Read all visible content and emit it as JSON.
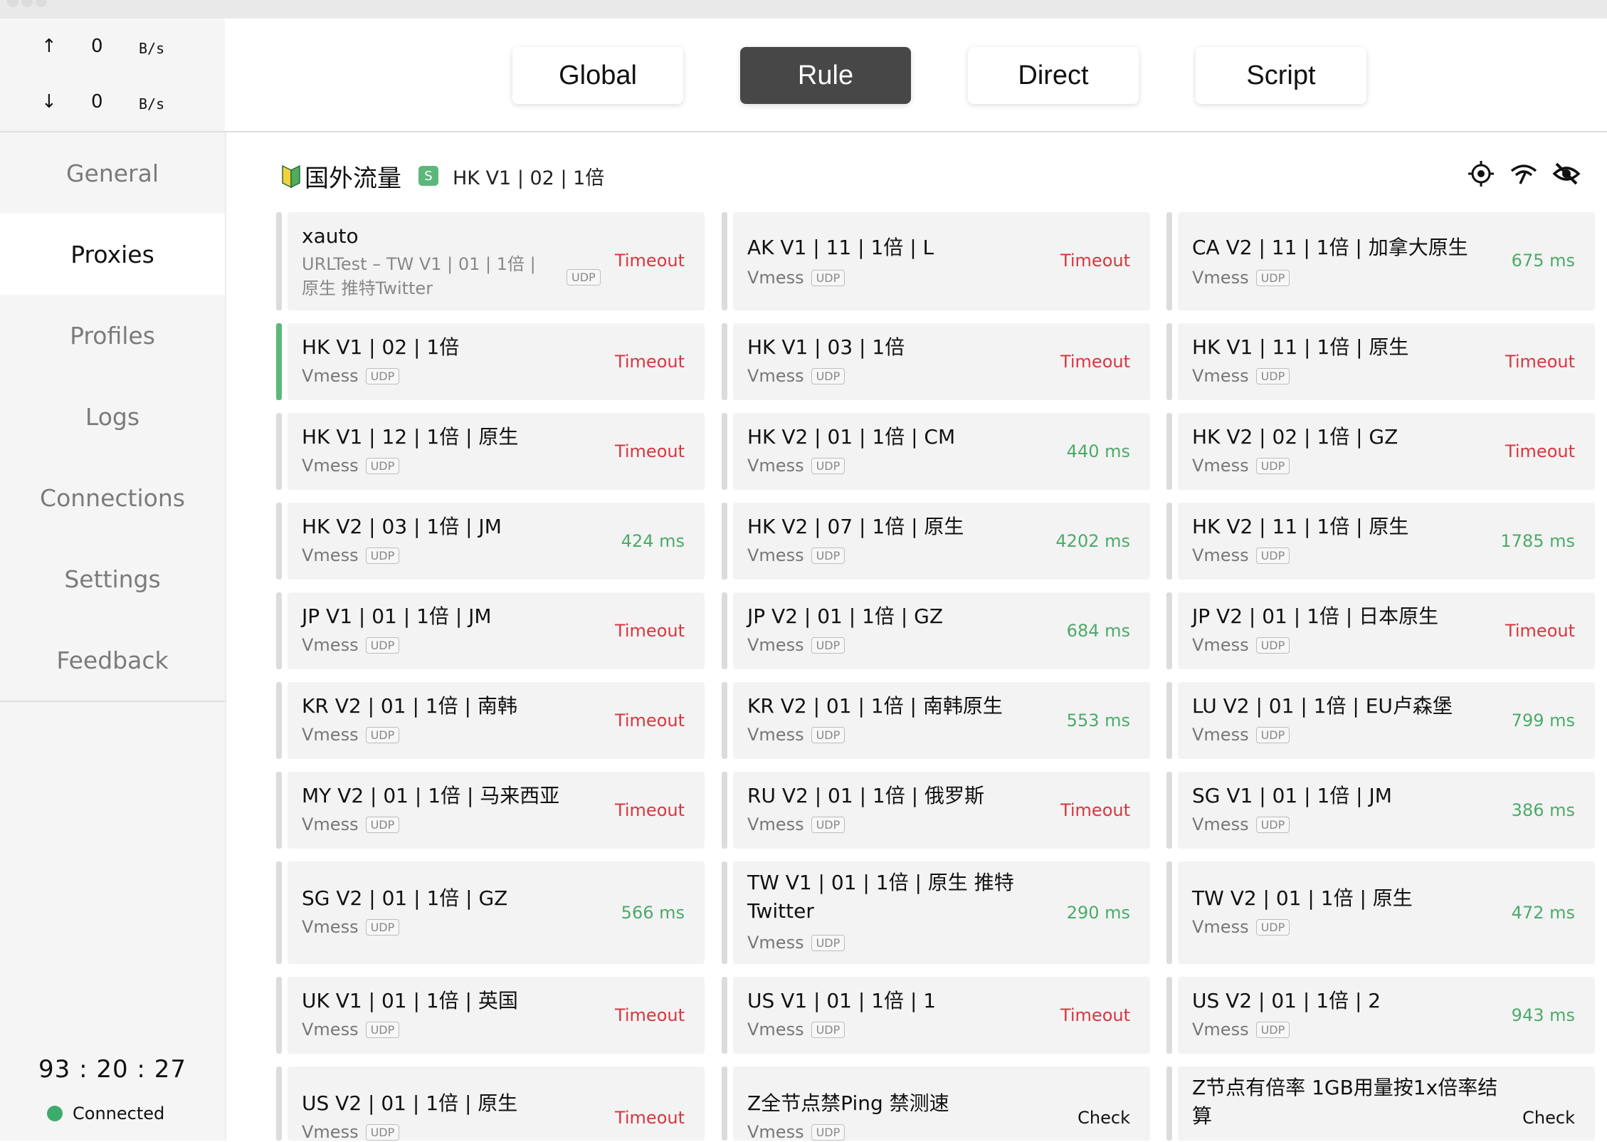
{
  "speed": {
    "up_arrow": "↑",
    "up_value": "0",
    "up_unit": "B/s",
    "down_arrow": "↓",
    "down_value": "0",
    "down_unit": "B/s"
  },
  "nav": {
    "items": [
      {
        "label": "General"
      },
      {
        "label": "Proxies"
      },
      {
        "label": "Profiles"
      },
      {
        "label": "Logs"
      },
      {
        "label": "Connections"
      },
      {
        "label": "Settings"
      },
      {
        "label": "Feedback"
      }
    ],
    "active": "Proxies"
  },
  "footer": {
    "clock": "93 : 20 : 27",
    "status": "Connected"
  },
  "modes": [
    {
      "label": "Global"
    },
    {
      "label": "Rule"
    },
    {
      "label": "Direct"
    },
    {
      "label": "Script"
    }
  ],
  "active_mode": "Rule",
  "group": {
    "title": "国外流量",
    "badge": "S",
    "selected": "HK V1 | 02 | 1倍",
    "icons": [
      "locate-icon",
      "wifi-speed-icon",
      "eye-off-icon"
    ]
  },
  "colors": {
    "accent": "#5cb87a",
    "timeout": "#d9363e",
    "ok": "#4caa6a",
    "active_mode_bg": "#474747"
  },
  "proxies": [
    {
      "name": "xauto",
      "type": "URLTest – TW V1 | 01 | 1倍 | 原生 推特Twitter",
      "udp": "UDP",
      "delay": "Timeout"
    },
    {
      "name": "AK V1 | 11 | 1倍 | L",
      "type": "Vmess",
      "udp": "UDP",
      "delay": "Timeout"
    },
    {
      "name": "CA V2 | 11 | 1倍 | 加拿大原生",
      "type": "Vmess",
      "udp": "UDP",
      "delay": "675 ms"
    },
    {
      "name": "HK V1 | 02 | 1倍",
      "type": "Vmess",
      "udp": "UDP",
      "delay": "Timeout"
    },
    {
      "name": "HK V1 | 03 | 1倍",
      "type": "Vmess",
      "udp": "UDP",
      "delay": "Timeout"
    },
    {
      "name": "HK V1 | 11 | 1倍 | 原生",
      "type": "Vmess",
      "udp": "UDP",
      "delay": "Timeout"
    },
    {
      "name": "HK V1 | 12 | 1倍 | 原生",
      "type": "Vmess",
      "udp": "UDP",
      "delay": "Timeout"
    },
    {
      "name": "HK V2 | 01 | 1倍 | CM",
      "type": "Vmess",
      "udp": "UDP",
      "delay": "440 ms"
    },
    {
      "name": "HK V2 | 02 | 1倍 | GZ",
      "type": "Vmess",
      "udp": "UDP",
      "delay": "Timeout"
    },
    {
      "name": "HK V2 | 03 | 1倍 | JM",
      "type": "Vmess",
      "udp": "UDP",
      "delay": "424 ms"
    },
    {
      "name": "HK V2 | 07 | 1倍 | 原生",
      "type": "Vmess",
      "udp": "UDP",
      "delay": "4202 ms"
    },
    {
      "name": "HK V2 | 11 | 1倍 | 原生",
      "type": "Vmess",
      "udp": "UDP",
      "delay": "1785 ms"
    },
    {
      "name": "JP V1 | 01 | 1倍 | JM",
      "type": "Vmess",
      "udp": "UDP",
      "delay": "Timeout"
    },
    {
      "name": "JP V2 | 01 | 1倍 | GZ",
      "type": "Vmess",
      "udp": "UDP",
      "delay": "684 ms"
    },
    {
      "name": "JP V2 | 01 | 1倍 | 日本原生",
      "type": "Vmess",
      "udp": "UDP",
      "delay": "Timeout"
    },
    {
      "name": "KR V2 | 01 | 1倍 | 南韩",
      "type": "Vmess",
      "udp": "UDP",
      "delay": "Timeout"
    },
    {
      "name": "KR V2 | 01 | 1倍 | 南韩原生",
      "type": "Vmess",
      "udp": "UDP",
      "delay": "553 ms"
    },
    {
      "name": "LU V2 | 01 | 1倍 | EU卢森堡",
      "type": "Vmess",
      "udp": "UDP",
      "delay": "799 ms"
    },
    {
      "name": "MY V2 | 01 | 1倍 | 马来西亚",
      "type": "Vmess",
      "udp": "UDP",
      "delay": "Timeout"
    },
    {
      "name": "RU V2 | 01 | 1倍 | 俄罗斯",
      "type": "Vmess",
      "udp": "UDP",
      "delay": "Timeout"
    },
    {
      "name": "SG V1 | 01 | 1倍 | JM",
      "type": "Vmess",
      "udp": "UDP",
      "delay": "386 ms"
    },
    {
      "name": "SG V2 | 01 | 1倍 | GZ",
      "type": "Vmess",
      "udp": "UDP",
      "delay": "566 ms"
    },
    {
      "name": "TW V1 | 01 | 1倍 | 原生 推特Twitter",
      "type": "Vmess",
      "udp": "UDP",
      "delay": "290 ms"
    },
    {
      "name": "TW V2 | 01 | 1倍 | 原生",
      "type": "Vmess",
      "udp": "UDP",
      "delay": "472 ms"
    },
    {
      "name": "UK V1 | 01 | 1倍 | 英国",
      "type": "Vmess",
      "udp": "UDP",
      "delay": "Timeout"
    },
    {
      "name": "US V1 | 01 | 1倍 | 1",
      "type": "Vmess",
      "udp": "UDP",
      "delay": "Timeout"
    },
    {
      "name": "US V2 | 01 | 1倍 | 2",
      "type": "Vmess",
      "udp": "UDP",
      "delay": "943 ms"
    },
    {
      "name": "US V2 | 01 | 1倍 | 原生",
      "type": "Vmess",
      "udp": "UDP",
      "delay": "Timeout"
    },
    {
      "name": "Z全节点禁Ping 禁测速",
      "type": "Vmess",
      "udp": "UDP",
      "delay": "Check"
    },
    {
      "name": "Z节点有倍率 1GB用量按1x倍率结算",
      "type": "",
      "udp": "",
      "delay": "Check"
    }
  ]
}
